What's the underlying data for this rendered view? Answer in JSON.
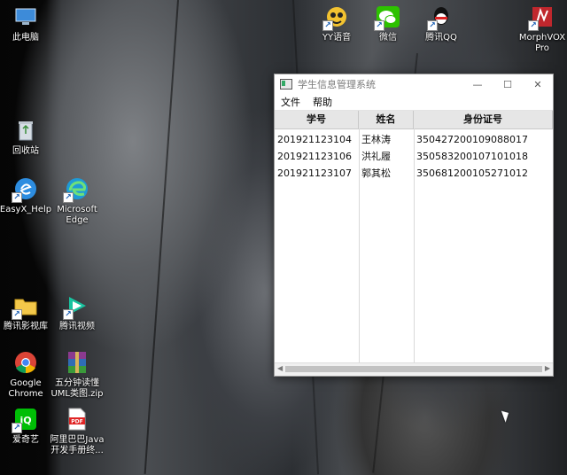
{
  "desktop": {
    "icons": [
      {
        "id": "this-pc",
        "label": "此电脑",
        "icon": "computer-icon",
        "color": "#3d8bd9"
      },
      {
        "id": "yy",
        "label": "YY语音",
        "icon": "yy-icon",
        "color": "#f2c230"
      },
      {
        "id": "wechat",
        "label": "微信",
        "icon": "wechat-icon",
        "color": "#2dc100"
      },
      {
        "id": "qq",
        "label": "腾讯QQ",
        "icon": "qq-icon",
        "color": "#ffffff"
      },
      {
        "id": "morphvox",
        "label": "MorphVOX Pro",
        "icon": "morphvox-icon",
        "color": "#c0272d"
      },
      {
        "id": "recycle",
        "label": "回收站",
        "icon": "recycle-bin-icon",
        "color": "#bfc7cf"
      },
      {
        "id": "easyx",
        "label": "EasyX_Help",
        "icon": "easyx-icon",
        "color": "#2d8de0"
      },
      {
        "id": "edge",
        "label": "Microsoft Edge",
        "icon": "edge-icon",
        "color": "#1e9bd7"
      },
      {
        "id": "tencent-video-lib",
        "label": "腾讯影视库",
        "icon": "folder-icon",
        "color": "#f3c84a"
      },
      {
        "id": "tencent-video",
        "label": "腾讯视频",
        "icon": "tencent-video-icon",
        "color": "#19c3a0"
      },
      {
        "id": "chrome",
        "label": "Google Chrome",
        "icon": "chrome-icon",
        "color": "#db4437"
      },
      {
        "id": "uml-zip",
        "label": "五分钟读懂UML类图.zip",
        "icon": "winrar-icon",
        "color": "#8b3a8f"
      },
      {
        "id": "iqiyi",
        "label": "爱奇艺",
        "icon": "iqiyi-icon",
        "color": "#00be06"
      },
      {
        "id": "alibaba-pdf",
        "label": "阿里巴巴Java开发手册终...",
        "icon": "pdf-icon",
        "color": "#e02424"
      }
    ]
  },
  "window": {
    "title": "学生信息管理系统",
    "minimize": "—",
    "maximize": "☐",
    "close": "✕",
    "menu": [
      "文件",
      "帮助"
    ],
    "table": {
      "columns": [
        "学号",
        "姓名",
        "身份证号"
      ],
      "rows": [
        [
          "201921123104",
          "王林涛",
          "350427200109088017"
        ],
        [
          "201921123106",
          "洪礼履",
          "350583200107101018"
        ],
        [
          "201921123107",
          "郭其松",
          "350681200105271012"
        ]
      ]
    }
  }
}
